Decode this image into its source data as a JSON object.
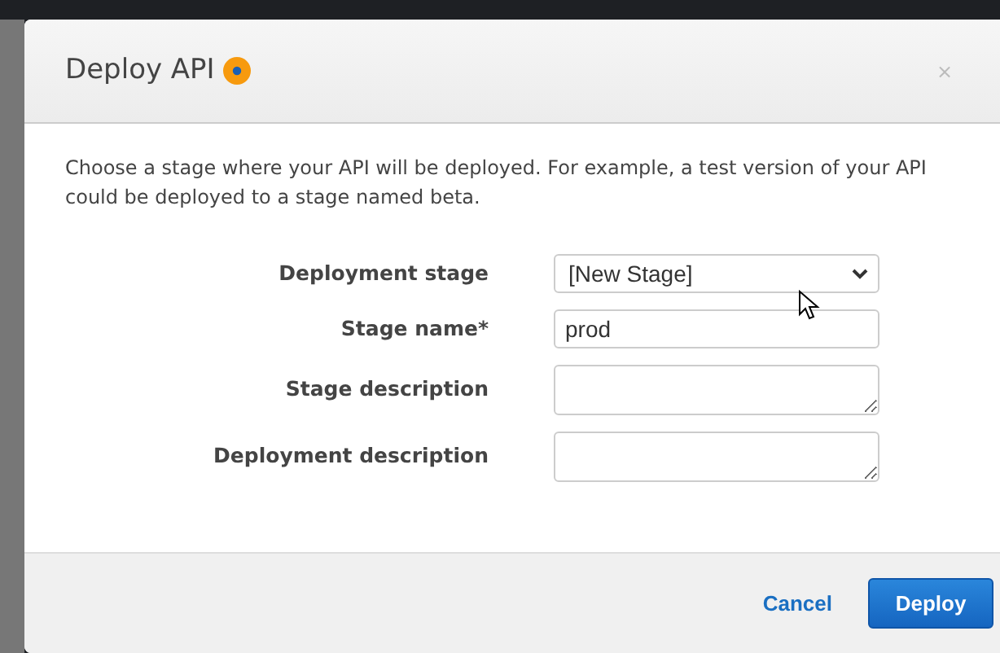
{
  "dialog": {
    "title": "Deploy API",
    "close": "×",
    "description": "Choose a stage where your API will be deployed. For example, a test version of your API could be deployed to a stage named beta.",
    "fields": [
      {
        "label": "Deployment stage",
        "kind": "select",
        "value": "[New Stage]"
      },
      {
        "label": "Stage name*",
        "kind": "input",
        "value": "prod"
      },
      {
        "label": "Stage description",
        "kind": "textarea"
      },
      {
        "label": "Deployment description",
        "kind": "textarea"
      }
    ],
    "buttons": [
      {
        "label": "Cancel",
        "kind": "link"
      },
      {
        "label": "Deploy",
        "kind": "primary"
      }
    ]
  }
}
